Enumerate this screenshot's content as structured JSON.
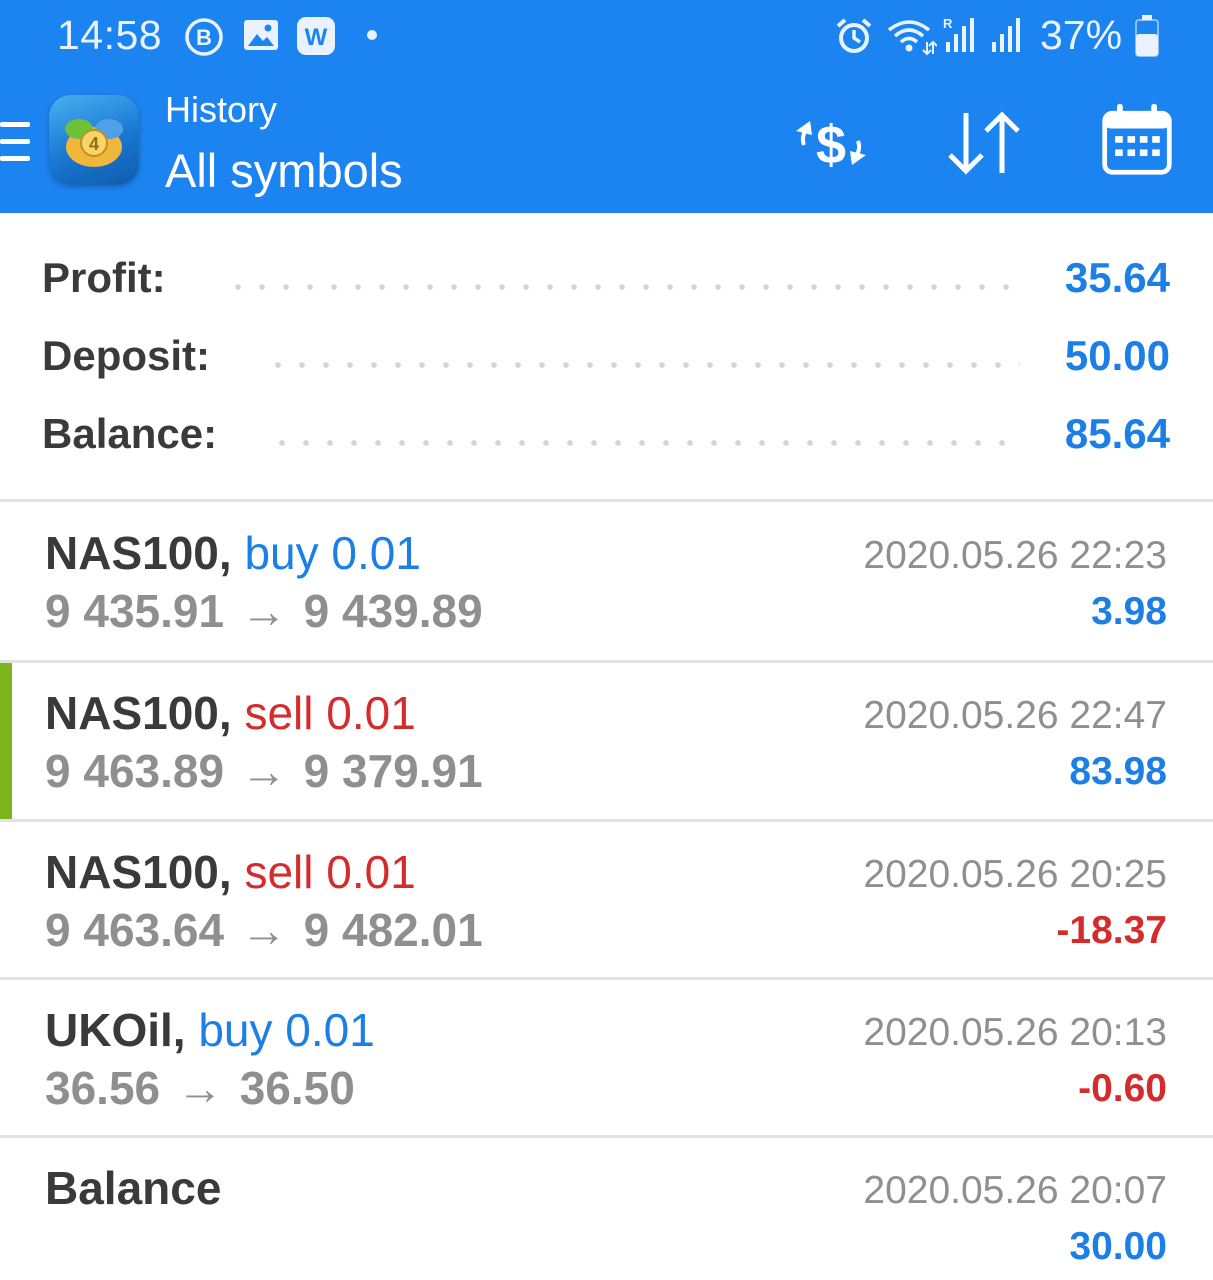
{
  "status_bar": {
    "time": "14:58",
    "battery": "37%",
    "icons": [
      "b-circle-icon",
      "image-icon",
      "w-app-icon",
      "dot-icon",
      "alarm-icon",
      "wifi-icon",
      "signal-r-icon",
      "signal-icon",
      "battery-icon"
    ]
  },
  "header": {
    "subtitle": "History",
    "title": "All symbols",
    "actions": [
      "currency-exchange-icon",
      "sort-icon",
      "calendar-icon"
    ]
  },
  "summary": {
    "profit_label": "Profit:",
    "profit_value": "35.64",
    "deposit_label": "Deposit:",
    "deposit_value": "50.00",
    "balance_label": "Balance:",
    "balance_value": "85.64"
  },
  "trades": [
    {
      "symbol": "NAS100,",
      "side": "buy",
      "volume": "0.01",
      "open": "9 435.91",
      "arrow": "→",
      "close": "9 439.89",
      "time": "2020.05.26 22:23",
      "profit": "3.98"
    },
    {
      "symbol": "NAS100,",
      "side": "sell",
      "volume": "0.01",
      "open": "9 463.89",
      "arrow": "→",
      "close": "9 379.91",
      "time": "2020.05.26 22:47",
      "profit": "83.98"
    },
    {
      "symbol": "NAS100,",
      "side": "sell",
      "volume": "0.01",
      "open": "9 463.64",
      "arrow": "→",
      "close": "9 482.01",
      "time": "2020.05.26 20:25",
      "profit": "-18.37"
    },
    {
      "symbol": "UKOil,",
      "side": "buy",
      "volume": "0.01",
      "open": "36.56",
      "arrow": "→",
      "close": "36.50",
      "time": "2020.05.26 20:13",
      "profit": "-0.60"
    }
  ],
  "balance_entry": {
    "label": "Balance",
    "time": "2020.05.26 20:07",
    "amount": "30.00"
  },
  "colors": {
    "header_blue": "#1c84f1",
    "value_blue": "#1b7fe5",
    "loss_red": "#d42c2c",
    "selected_accent": "#7cb51c"
  }
}
